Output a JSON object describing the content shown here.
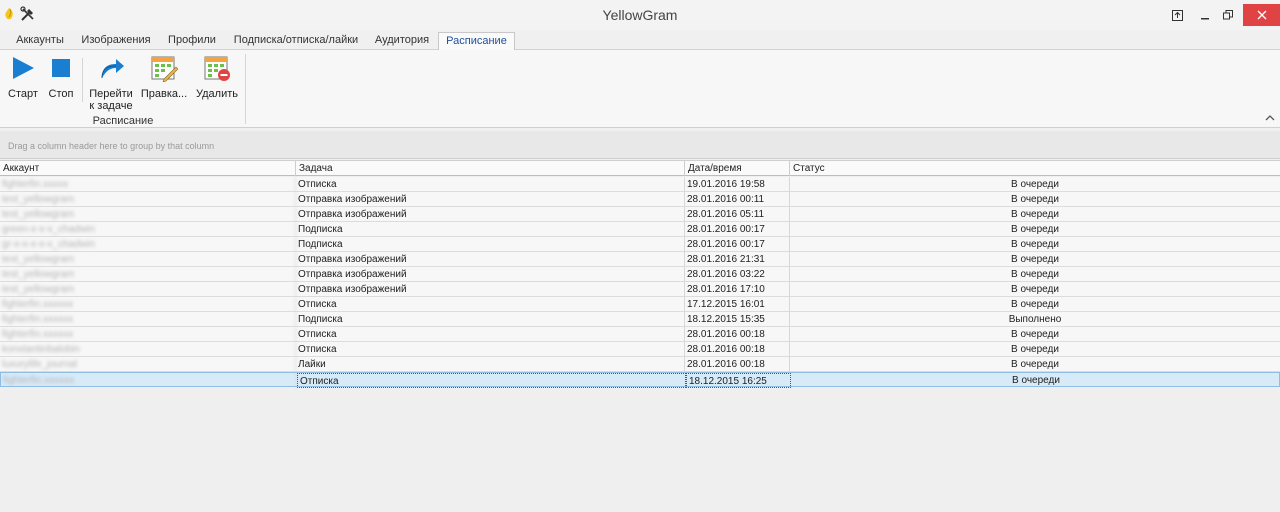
{
  "window": {
    "title": "YellowGram"
  },
  "tabs": [
    "Аккаунты",
    "Изображения",
    "Профили",
    "Подписка/отписка/лайки",
    "Аудитория",
    "Расписание"
  ],
  "active_tab": "Расписание",
  "ribbon": {
    "start_label": "Старт",
    "stop_label": "Стоп",
    "goto_label_line1": "Перейти",
    "goto_label_line2": "к задаче",
    "edit_label": "Правка...",
    "delete_label": "Удалить",
    "group_label": "Расписание"
  },
  "grid": {
    "group_hint": "Drag a column header here to group by that column",
    "columns": [
      "Аккаунт",
      "Задача",
      "Дата/время",
      "Статус"
    ],
    "rows": [
      {
        "account": "fighterfin.xxxxx",
        "task": "Отписка",
        "date": "19.01.2016 19:58",
        "status": "В очереди"
      },
      {
        "account": "test_yellowgram",
        "task": "Отправка изображений",
        "date": "28.01.2016 00:11",
        "status": "В очереди"
      },
      {
        "account": "test_yellowgram",
        "task": "Отправка изображений",
        "date": "28.01.2016 05:11",
        "status": "В очереди"
      },
      {
        "account": "green-x-x-x_chadwin",
        "task": "Подписка",
        "date": "28.01.2016 00:17",
        "status": "В очереди"
      },
      {
        "account": "gr-x-x-x-x-x_chadwin",
        "task": "Подписка",
        "date": "28.01.2016 00:17",
        "status": "В очереди"
      },
      {
        "account": "test_yellowgram",
        "task": "Отправка изображений",
        "date": "28.01.2016 21:31",
        "status": "В очереди"
      },
      {
        "account": "test_yellowgram",
        "task": "Отправка изображений",
        "date": "28.01.2016 03:22",
        "status": "В очереди"
      },
      {
        "account": "test_yellowgram",
        "task": "Отправка изображений",
        "date": "28.01.2016 17:10",
        "status": "В очереди"
      },
      {
        "account": "fighterfin.xxxxxx",
        "task": "Отписка",
        "date": "17.12.2015 16:01",
        "status": "В очереди"
      },
      {
        "account": "fighterfin.xxxxxx",
        "task": "Подписка",
        "date": "18.12.2015 15:35",
        "status": "Выполнено"
      },
      {
        "account": "fighterfin.xxxxxx",
        "task": "Отписка",
        "date": "28.01.2016 00:18",
        "status": "В очереди"
      },
      {
        "account": "konstantinbalobin",
        "task": "Отписка",
        "date": "28.01.2016 00:18",
        "status": "В очереди"
      },
      {
        "account": "luxurylife_journal",
        "task": "Лайки",
        "date": "28.01.2016 00:18",
        "status": "В очереди"
      },
      {
        "account": "fighterfin.xxxxxx",
        "task": "Отписка",
        "date": "18.12.2015 16:25",
        "status": "В очереди",
        "selected": true
      }
    ]
  },
  "colors": {
    "close_button": "#e04343",
    "active_tab_text": "#1f4e9c",
    "selected_row": "#d7eaf8",
    "play_icon": "#1a7fd0"
  }
}
